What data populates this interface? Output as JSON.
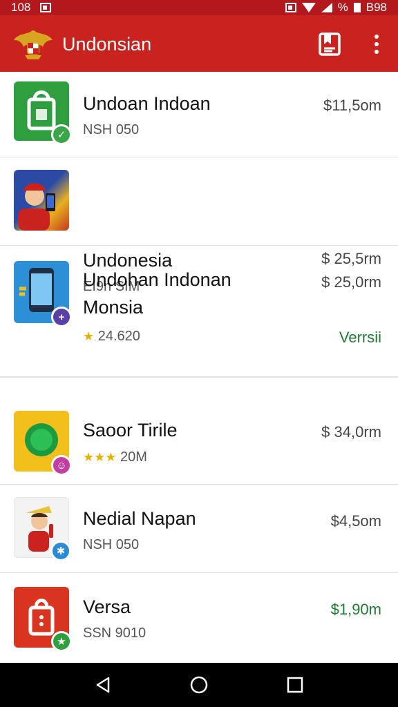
{
  "status_bar": {
    "time": "108",
    "notification_icon": "image-icon",
    "battery_text": "%",
    "right_text": "B98",
    "icons": [
      "sim-icon",
      "wifi-icon",
      "signal-icon",
      "battery-icon"
    ]
  },
  "app_bar": {
    "title": "Undonsian",
    "logo": "garuda-emblem",
    "action_icon": "bookmark-page-icon",
    "overflow_icon": "more-vert-icon",
    "accent": "#c9221f"
  },
  "apps": [
    {
      "name": "Undoan Indoan",
      "subtitle": "NSH 050",
      "price": "$11,5om",
      "icon": "shopping-bag-icon",
      "icon_color": "#2f9e3f",
      "badge": "check-badge",
      "badge_color": "#3aa648",
      "price_color": "#444444"
    },
    {
      "name": "Undonesia",
      "subtitle": "EI9n SIM",
      "price": "$ 25,5rm",
      "icon": "man-with-phone-icon",
      "icon_color": "#2a4aa6",
      "badge": "",
      "badge_color": "",
      "price_color": "#444444"
    },
    {
      "name": "Undohan Indonan",
      "name_line2": "Monsia",
      "rating_stars": "★",
      "rating": "24.620",
      "price": "$ 25,0rm",
      "tag": "Verrsii",
      "icon": "smartphone-icon",
      "icon_color": "#2d8fd6",
      "badge": "plus-badge",
      "badge_color": "#5a3fa8",
      "price_color": "#444444"
    },
    {
      "name": "Saoor Tirile",
      "rating_stars": "★★★",
      "rating": "20M",
      "price": "$ 34,0rm",
      "icon": "circle-app-icon",
      "icon_color": "#f2bf1b",
      "badge": "emoji-badge",
      "badge_color": "#c23ea0",
      "price_color": "#444444"
    },
    {
      "name": "Nedial Napan",
      "subtitle": "NSH 050",
      "price": "$4,5om",
      "icon": "cartoon-boy-icon",
      "icon_color": "#f3f3f3",
      "badge": "sun-badge",
      "badge_color": "#2a8bd6",
      "price_color": "#444444"
    },
    {
      "name": "Versa",
      "subtitle": "SSN 9010",
      "price": "$1,90m",
      "icon": "red-bag-icon",
      "icon_color": "#d9341f",
      "badge": "star-badge",
      "badge_color": "#2f9e3f",
      "price_color": "#1c7c2f"
    }
  ],
  "nav_bar": {
    "back": "back-icon",
    "home": "home-icon",
    "recents": "recents-icon"
  }
}
